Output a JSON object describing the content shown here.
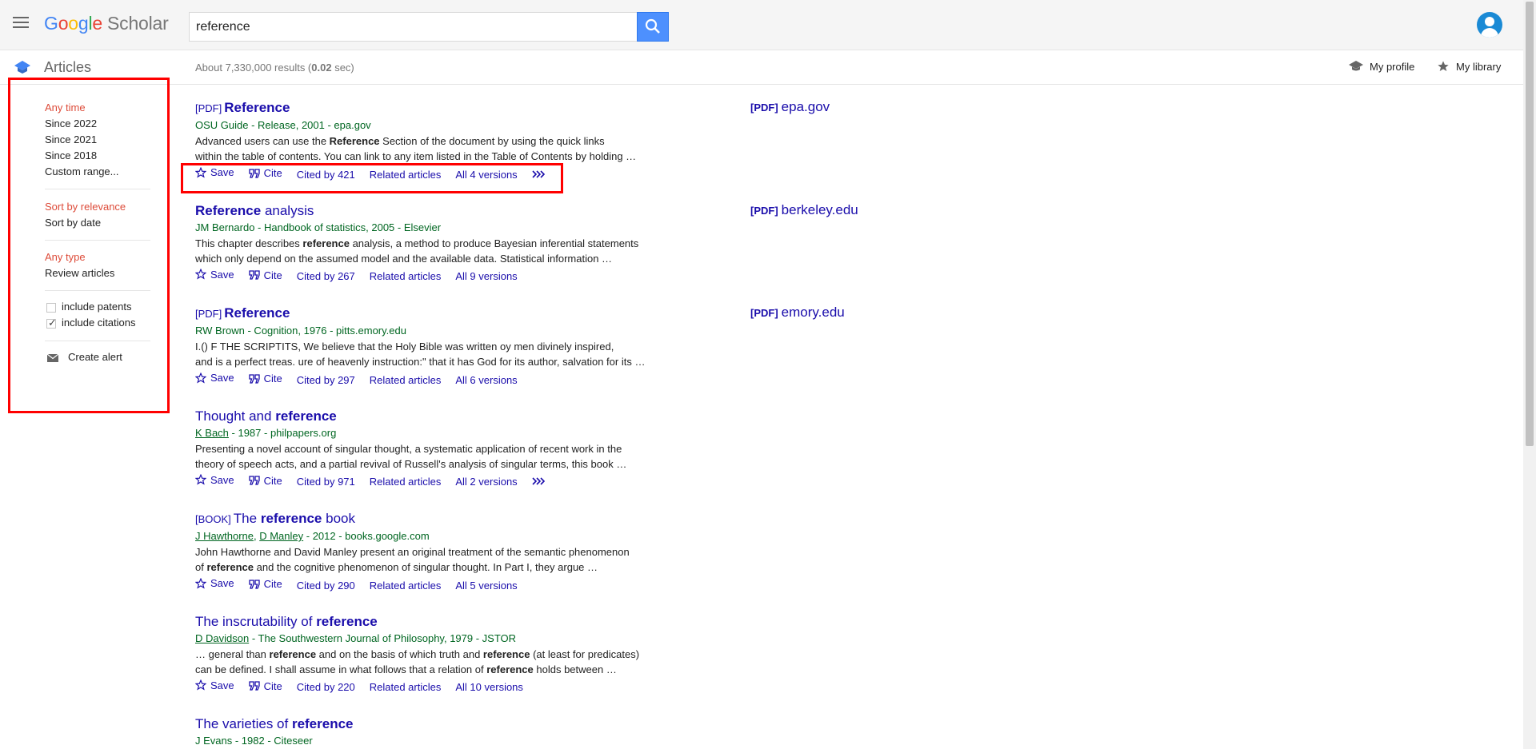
{
  "header": {
    "logo_letters": [
      "G",
      "o",
      "o",
      "g",
      "l",
      "e"
    ],
    "logo_suffix": "Scholar",
    "search_value": "reference"
  },
  "subbar": {
    "articles_label": "Articles",
    "results_prefix": "About 7,330,000 results (",
    "results_time": "0.02",
    "results_suffix": " sec)",
    "my_profile": "My profile",
    "my_library": "My library"
  },
  "sidebar": {
    "time_filters": [
      "Any time",
      "Since 2022",
      "Since 2021",
      "Since 2018",
      "Custom range..."
    ],
    "sort_options": [
      "Sort by relevance",
      "Sort by date"
    ],
    "type_options": [
      "Any type",
      "Review articles"
    ],
    "include_patents": "include patents",
    "include_citations": "include citations",
    "include_patents_checked": false,
    "include_citations_checked": true,
    "create_alert": "Create alert"
  },
  "results": [
    {
      "tag": "[PDF]",
      "title_parts": [
        {
          "t": "Reference",
          "b": true
        }
      ],
      "meta": "OSU Guide - Release, 2001 - epa.gov",
      "snippet_lines": [
        [
          {
            "t": "Advanced users can use the "
          },
          {
            "t": "Reference",
            "b": true
          },
          {
            "t": " Section of the document by using the quick links"
          }
        ],
        [
          {
            "t": "within the table of contents. You can link to any item listed in the Table of Contents by holding …"
          }
        ]
      ],
      "actions": [
        "Save",
        "Cite",
        "Cited by 421",
        "Related articles",
        "All 4 versions"
      ],
      "more": true,
      "side_tag": "[PDF]",
      "side_domain": "epa.gov"
    },
    {
      "tag": "",
      "title_parts": [
        {
          "t": "Reference",
          "b": true
        },
        {
          "t": " analysis"
        }
      ],
      "meta": "JM Bernardo - Handbook of statistics, 2005 - Elsevier",
      "snippet_lines": [
        [
          {
            "t": "This chapter describes "
          },
          {
            "t": "reference",
            "b": true
          },
          {
            "t": " analysis, a method to produce Bayesian inferential statements"
          }
        ],
        [
          {
            "t": "which only depend on the assumed model and the available data. Statistical information …"
          }
        ]
      ],
      "actions": [
        "Save",
        "Cite",
        "Cited by 267",
        "Related articles",
        "All 9 versions"
      ],
      "more": false,
      "side_tag": "[PDF]",
      "side_domain": "berkeley.edu"
    },
    {
      "tag": "[PDF]",
      "title_parts": [
        {
          "t": "Reference",
          "b": true
        }
      ],
      "meta": "RW Brown - Cognition, 1976 - pitts.emory.edu",
      "snippet_lines": [
        [
          {
            "t": "I.() F THE SCRIPTITS, We believe that the Holy Bible was written oy men divinely inspired,"
          }
        ],
        [
          {
            "t": "and is a perfect treas. ure of heavenly instruction:\" that it has God for its author, salvation for its …"
          }
        ]
      ],
      "actions": [
        "Save",
        "Cite",
        "Cited by 297",
        "Related articles",
        "All 6 versions"
      ],
      "more": false,
      "side_tag": "[PDF]",
      "side_domain": "emory.edu"
    },
    {
      "tag": "",
      "title_parts": [
        {
          "t": "Thought and "
        },
        {
          "t": "reference",
          "b": true
        }
      ],
      "meta_authors": [
        "K Bach"
      ],
      "meta": " - 1987 - philpapers.org",
      "snippet_lines": [
        [
          {
            "t": "Presenting a novel account of singular thought, a systematic application of recent work in the"
          }
        ],
        [
          {
            "t": "theory of speech acts, and a partial revival of Russell's analysis of singular terms, this book …"
          }
        ]
      ],
      "actions": [
        "Save",
        "Cite",
        "Cited by 971",
        "Related articles",
        "All 2 versions"
      ],
      "more": true
    },
    {
      "tag": "[BOOK]",
      "title_parts": [
        {
          "t": "The "
        },
        {
          "t": "reference",
          "b": true
        },
        {
          "t": " book"
        }
      ],
      "meta_authors": [
        "J Hawthorne",
        "D Manley"
      ],
      "meta": " - 2012 - books.google.com",
      "snippet_lines": [
        [
          {
            "t": "John Hawthorne and David Manley present an original treatment of the semantic phenomenon"
          }
        ],
        [
          {
            "t": "of "
          },
          {
            "t": "reference",
            "b": true
          },
          {
            "t": " and the cognitive phenomenon of singular thought. In Part I, they argue …"
          }
        ]
      ],
      "actions": [
        "Save",
        "Cite",
        "Cited by 290",
        "Related articles",
        "All 5 versions"
      ],
      "more": false
    },
    {
      "tag": "",
      "title_parts": [
        {
          "t": "The inscrutability of "
        },
        {
          "t": "reference",
          "b": true
        }
      ],
      "meta_authors": [
        "D Davidson"
      ],
      "meta": " - The Southwestern Journal of Philosophy, 1979 - JSTOR",
      "snippet_lines": [
        [
          {
            "t": "… general than "
          },
          {
            "t": "reference",
            "b": true
          },
          {
            "t": " and on the basis of which truth and "
          },
          {
            "t": "reference",
            "b": true
          },
          {
            "t": " (at least for predicates)"
          }
        ],
        [
          {
            "t": "can be defined. I shall assume in what follows that a relation of "
          },
          {
            "t": "reference",
            "b": true
          },
          {
            "t": " holds between …"
          }
        ]
      ],
      "actions": [
        "Save",
        "Cite",
        "Cited by 220",
        "Related articles",
        "All 10 versions"
      ],
      "more": false
    },
    {
      "tag": "",
      "title_parts": [
        {
          "t": "The varieties of "
        },
        {
          "t": "reference",
          "b": true
        }
      ],
      "meta": "J Evans - 1982 - Citeseer",
      "snippet_lines": [],
      "actions": [],
      "more": false
    }
  ]
}
